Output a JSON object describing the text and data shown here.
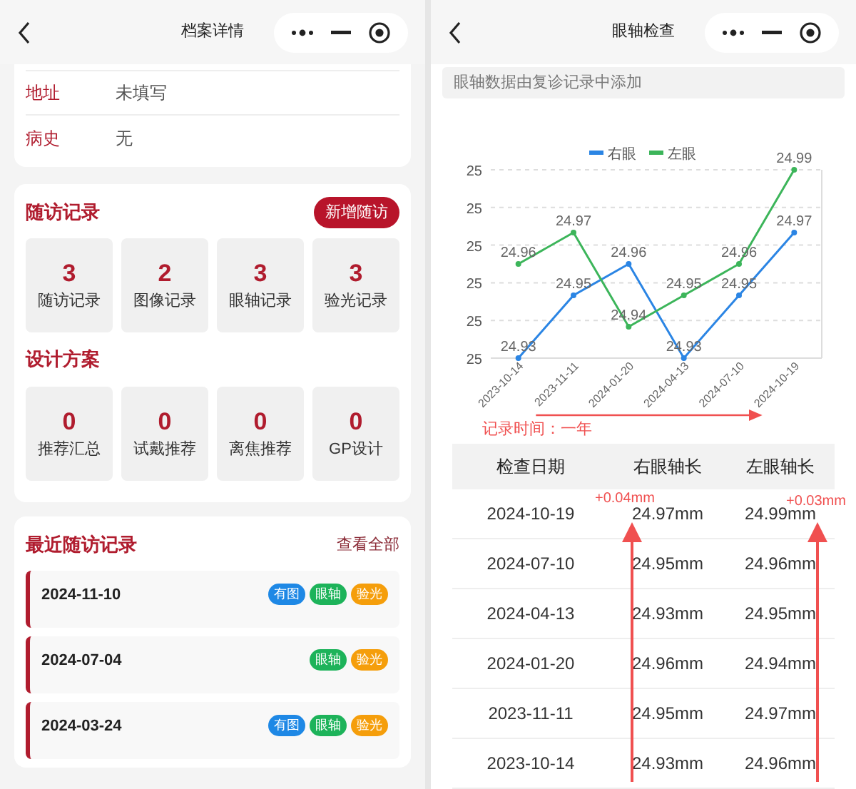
{
  "left_screen": {
    "nav_title": "档案详情",
    "info_rows": [
      {
        "label": "地址",
        "value": "未填写"
      },
      {
        "label": "病史",
        "value": "无"
      }
    ],
    "followup": {
      "title": "随访记录",
      "button": "新增随访",
      "stats": [
        {
          "count": "3",
          "label": "随访记录"
        },
        {
          "count": "2",
          "label": "图像记录"
        },
        {
          "count": "3",
          "label": "眼轴记录"
        },
        {
          "count": "3",
          "label": "验光记录"
        }
      ]
    },
    "design": {
      "title": "设计方案",
      "stats": [
        {
          "count": "0",
          "label": "推荐汇总"
        },
        {
          "count": "0",
          "label": "试戴推荐"
        },
        {
          "count": "0",
          "label": "离焦推荐"
        },
        {
          "count": "0",
          "label": "GP设计"
        }
      ]
    },
    "recent": {
      "title": "最近随访记录",
      "link": "查看全部",
      "items": [
        {
          "date": "2024-11-10",
          "tags": [
            {
              "label": "有图",
              "color": "#1e88e5"
            },
            {
              "label": "眼轴",
              "color": "#1db35a"
            },
            {
              "label": "验光",
              "color": "#f59e0b"
            }
          ]
        },
        {
          "date": "2024-07-04",
          "tags": [
            {
              "label": "眼轴",
              "color": "#1db35a"
            },
            {
              "label": "验光",
              "color": "#f59e0b"
            }
          ]
        },
        {
          "date": "2024-03-24",
          "tags": [
            {
              "label": "有图",
              "color": "#1e88e5"
            },
            {
              "label": "眼轴",
              "color": "#1db35a"
            },
            {
              "label": "验光",
              "color": "#f59e0b"
            }
          ]
        }
      ]
    }
  },
  "right_screen": {
    "nav_title": "眼轴检查",
    "notice": "眼轴数据由复诊记录中添加",
    "chart_data": {
      "type": "line",
      "categories": [
        "2023-10-14",
        "2023-11-11",
        "2024-01-20",
        "2024-04-13",
        "2024-07-10",
        "2024-10-19"
      ],
      "legend": true,
      "grid": true,
      "series": [
        {
          "name": "右眼",
          "color": "#2b85e4",
          "marker": "circle",
          "values": [
            24.93,
            24.95,
            24.96,
            24.93,
            24.95,
            24.97
          ]
        },
        {
          "name": "左眼",
          "color": "#3cb55a",
          "marker": "circle",
          "values": [
            24.96,
            24.97,
            24.94,
            24.95,
            24.96,
            24.99
          ]
        }
      ],
      "ylim": [
        24.93,
        24.99
      ],
      "yticks": [
        {
          "value": 24.93,
          "label": "25"
        },
        {
          "value": 24.942,
          "label": "25"
        },
        {
          "value": 24.954,
          "label": "25"
        },
        {
          "value": 24.966,
          "label": "25"
        },
        {
          "value": 24.978,
          "label": "25"
        },
        {
          "value": 24.99,
          "label": "25"
        }
      ],
      "data_labels": true
    },
    "time_note": "记录时间：一年",
    "table": {
      "columns": [
        "检查日期",
        "右眼轴长",
        "左眼轴长"
      ],
      "rows": [
        [
          "2024-10-19",
          "24.97mm",
          "24.99mm"
        ],
        [
          "2024-07-10",
          "24.95mm",
          "24.96mm"
        ],
        [
          "2024-04-13",
          "24.93mm",
          "24.95mm"
        ],
        [
          "2024-01-20",
          "24.96mm",
          "24.94mm"
        ],
        [
          "2023-11-11",
          "24.95mm",
          "24.97mm"
        ],
        [
          "2023-10-14",
          "24.93mm",
          "24.96mm"
        ]
      ]
    },
    "deltas": [
      "+0.04mm",
      "+0.03mm"
    ]
  }
}
